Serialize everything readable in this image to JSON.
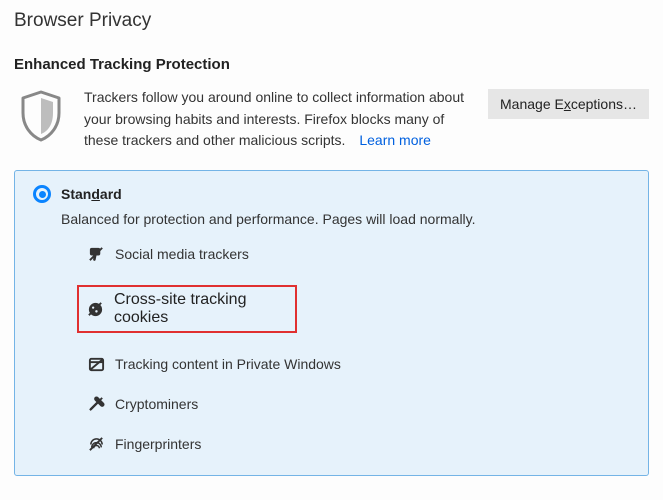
{
  "page": {
    "title": "Browser Privacy"
  },
  "etp": {
    "heading": "Enhanced Tracking Protection",
    "description": "Trackers follow you around online to collect information about your browsing habits and interests. Firefox blocks many of these trackers and other malicious scripts.",
    "learn_more": "Learn more",
    "manage_pre": "Manage E",
    "manage_u": "x",
    "manage_post": "ceptions…"
  },
  "option": {
    "standard_pre": "Stan",
    "standard_u": "d",
    "standard_post": "ard",
    "desc": "Balanced for protection and performance. Pages will load normally.",
    "trackers": {
      "social": "Social media trackers",
      "cookies": "Cross-site tracking cookies",
      "content": "Tracking content in Private Windows",
      "crypto": "Cryptominers",
      "finger": "Fingerprinters"
    }
  }
}
